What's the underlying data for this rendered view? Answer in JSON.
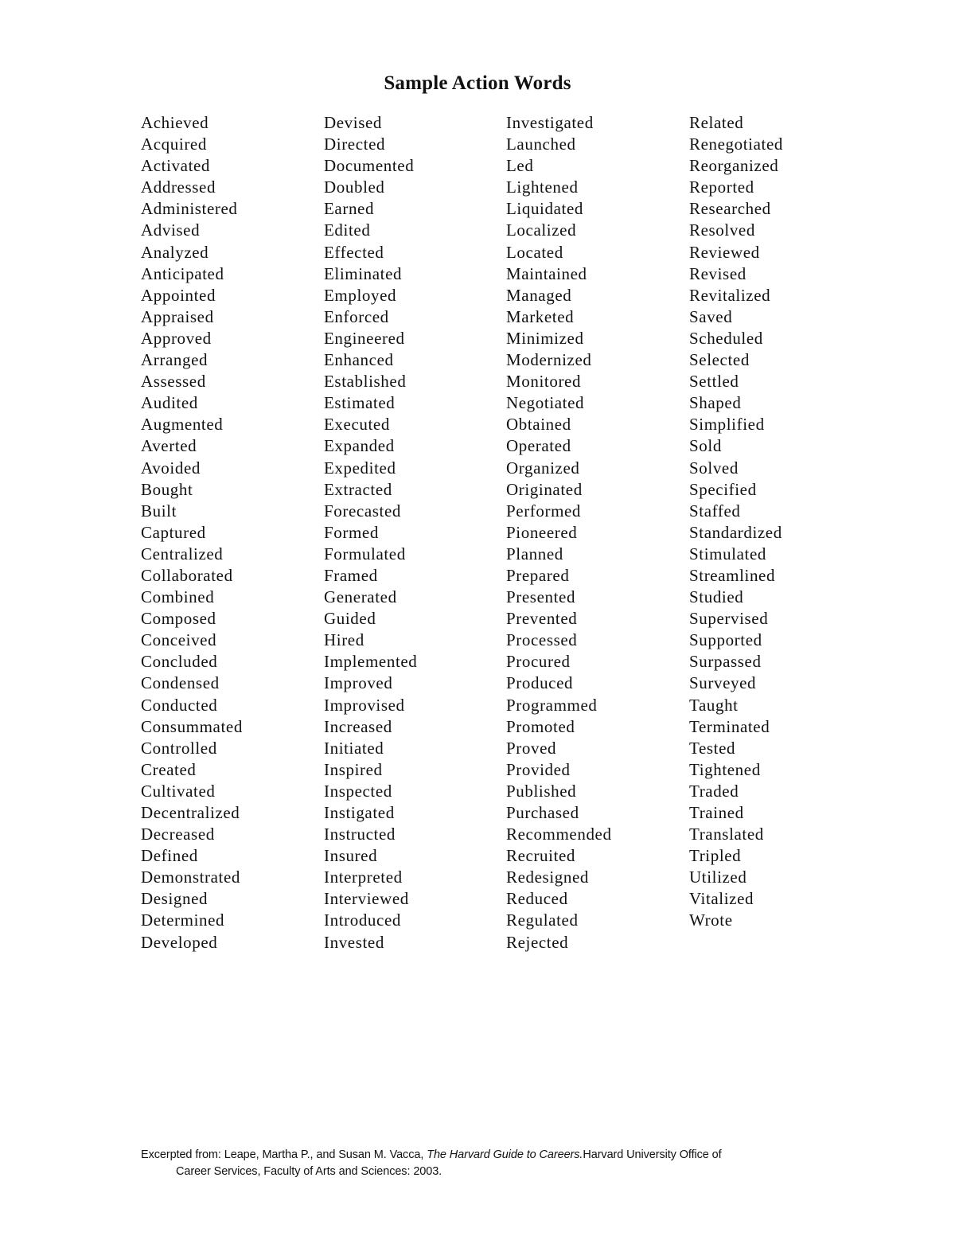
{
  "document": {
    "title": "Sample Action Words",
    "columns": [
      [
        "Achieved",
        "Acquired",
        "Activated",
        "Addressed",
        "Administered",
        "Advised",
        "Analyzed",
        "Anticipated",
        "Appointed",
        "Appraised",
        "Approved",
        "Arranged",
        "Assessed",
        "Audited",
        "Augmented",
        "Averted",
        "Avoided",
        "Bought",
        "Built",
        "Captured",
        "Centralized",
        "Collaborated",
        "Combined",
        "Composed",
        "Conceived",
        "Concluded",
        "Condensed",
        "Conducted",
        "Consummated",
        "Controlled",
        "Created",
        "Cultivated",
        "Decentralized",
        "Decreased",
        "Defined",
        "Demonstrated",
        "Designed",
        "Determined",
        "Developed"
      ],
      [
        "Devised",
        "Directed",
        "Documented",
        "Doubled",
        "Earned",
        "Edited",
        "Effected",
        "Eliminated",
        "Employed",
        "Enforced",
        "Engineered",
        "Enhanced",
        "Established",
        "Estimated",
        "Executed",
        "Expanded",
        "Expedited",
        "Extracted",
        "Forecasted",
        "Formed",
        "Formulated",
        "Framed",
        "Generated",
        "Guided",
        "Hired",
        "Implemented",
        "Improved",
        "Improvised",
        "Increased",
        "Initiated",
        "Inspired",
        "Inspected",
        "Instigated",
        "Instructed",
        "Insured",
        "Interpreted",
        "Interviewed",
        "Introduced",
        "Invested"
      ],
      [
        "Investigated",
        "Launched",
        "Led",
        "Lightened",
        "Liquidated",
        "Localized",
        "Located",
        "Maintained",
        "Managed",
        "Marketed",
        "Minimized",
        "Modernized",
        "Monitored",
        "Negotiated",
        "Obtained",
        "Operated",
        "Organized",
        "Originated",
        "Performed",
        "Pioneered",
        "Planned",
        "Prepared",
        "Presented",
        "Prevented",
        "Processed",
        "Procured",
        "Produced",
        "Programmed",
        "Promoted",
        "Proved",
        "Provided",
        "Published",
        "Purchased",
        "Recommended",
        "Recruited",
        "Redesigned",
        "Reduced",
        "Regulated",
        "Rejected"
      ],
      [
        "Related",
        "Renegotiated",
        "Reorganized",
        "Reported",
        "Researched",
        "Resolved",
        "Reviewed",
        "Revised",
        "Revitalized",
        "Saved",
        "Scheduled",
        "Selected",
        "Settled",
        "Shaped",
        "Simplified",
        "Sold",
        "Solved",
        "Specified",
        "Staffed",
        "Standardized",
        "Stimulated",
        "Streamlined",
        "Studied",
        "Supervised",
        "Supported",
        "Surpassed",
        "Surveyed",
        "Taught",
        "Terminated",
        "Tested",
        "Tightened",
        "Traded",
        "Trained",
        "Translated",
        "Tripled",
        "Utilized",
        "Vitalized",
        "Wrote"
      ]
    ],
    "footer": {
      "prefix": "Excerpted from: Leape, Martha P., and Susan M. Vacca, ",
      "book_title": "The Harvard Guide to Careers.",
      "suffix_line1": "Harvard University Office of",
      "line2": "Career Services, Faculty of Arts and Sciences: 2003."
    }
  }
}
